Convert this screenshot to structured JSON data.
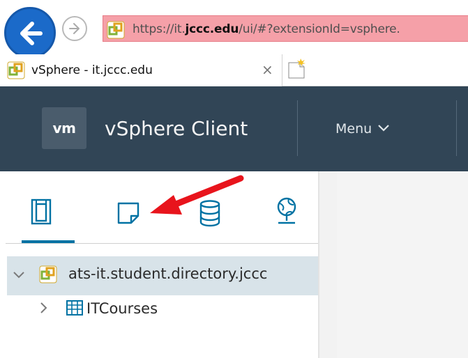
{
  "browser": {
    "url_prefix": "https://it.",
    "url_domain": "jccc.edu",
    "url_suffix": "/ui/#?extensionId=vsphere.",
    "tab_title": "vSphere - it.jccc.edu",
    "tab_close": "×"
  },
  "app": {
    "logo_text": "vm",
    "title": "vSphere Client",
    "menu_label": "Menu"
  },
  "navigator": {
    "tabs": [
      "hosts-and-clusters",
      "vms-and-templates",
      "storage",
      "networking"
    ],
    "selected_tab": "hosts-and-clusters"
  },
  "tree": {
    "root_label": "ats-it.student.directory.jccc",
    "child_label": "ITCourses"
  },
  "colors": {
    "header_bg": "#314556",
    "accent_blue": "#0072a3",
    "selected_row": "#d8e3e9",
    "annotation_red": "#e8141c"
  }
}
